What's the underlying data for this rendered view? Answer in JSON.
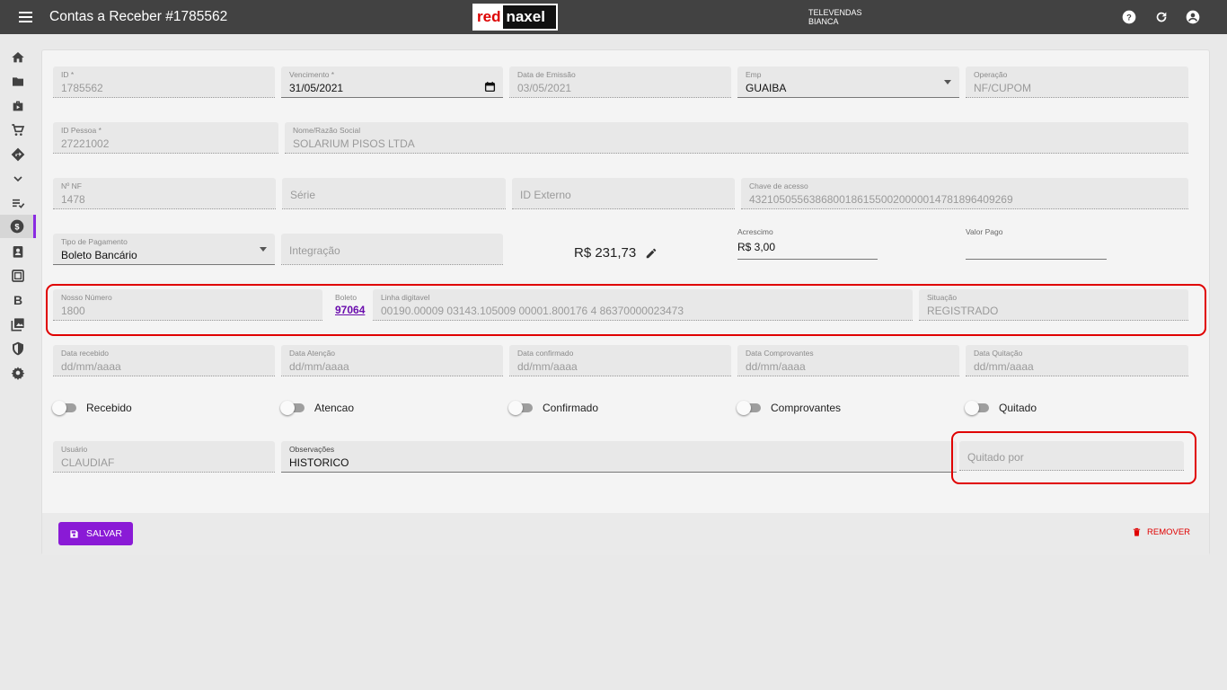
{
  "header": {
    "title": "Contas a Receber #1785562",
    "logo_red": "red",
    "logo_rest": "naxel",
    "user_line1": "TELEVENDAS",
    "user_line2": "BIANCA"
  },
  "sidebar": {
    "items": [
      "home-icon",
      "folder-icon",
      "briefcase-icon",
      "cart-icon",
      "directions-icon",
      "chevron-down-icon",
      "playlist-check-icon",
      "dollar-icon",
      "assignment-icon",
      "inbox-icon",
      "B",
      "photo-library-icon",
      "shield-icon",
      "gear-icon"
    ],
    "active": "dollar-icon",
    "b_label": "B"
  },
  "form": {
    "id": {
      "label": "ID *",
      "value": "1785562"
    },
    "vencimento": {
      "label": "Vencimento *",
      "value": "31/05/2021"
    },
    "data_emissao": {
      "label": "Data de Emissão",
      "value": "03/05/2021"
    },
    "emp": {
      "label": "Emp",
      "value": "GUAIBA"
    },
    "operacao": {
      "label": "Operação",
      "value": "NF/CUPOM"
    },
    "id_pessoa": {
      "label": "ID Pessoa *",
      "value": "27221002"
    },
    "nome": {
      "label": "Nome/Razão Social",
      "value": "SOLARIUM PISOS LTDA"
    },
    "nf": {
      "label": "Nº NF",
      "value": "1478"
    },
    "serie": {
      "placeholder": "Série"
    },
    "id_externo": {
      "placeholder": "ID Externo"
    },
    "chave": {
      "label": "Chave de acesso",
      "value": "43210505563868001861550020000014781896409269"
    },
    "tipo_pagamento": {
      "label": "Tipo de Pagamento",
      "value": "Boleto Bancário"
    },
    "integracao": {
      "placeholder": "Integração"
    },
    "valor": "R$ 231,73",
    "acrescimo": {
      "label": "Acrescimo",
      "value": "R$ 3,00"
    },
    "valor_pago": {
      "label": "Valor Pago",
      "value": ""
    },
    "nosso_numero": {
      "label": "Nosso Número",
      "value": "1800"
    },
    "boleto": {
      "label": "Boleto",
      "value": "97064"
    },
    "linha_digitavel": {
      "label": "Linha digitavel",
      "value": "00190.00009 03143.105009 00001.800176 4 86370000023473"
    },
    "situacao": {
      "label": "Situação",
      "value": "REGISTRADO"
    },
    "data_recebido": {
      "label": "Data recebido",
      "value": "dd/mm/aaaa"
    },
    "data_atencao": {
      "label": "Data Atenção",
      "value": "dd/mm/aaaa"
    },
    "data_confirmado": {
      "label": "Data confirmado",
      "value": "dd/mm/aaaa"
    },
    "data_comprovantes": {
      "label": "Data Comprovantes",
      "value": "dd/mm/aaaa"
    },
    "data_quitacao": {
      "label": "Data Quitação",
      "value": "dd/mm/aaaa"
    },
    "toggles": [
      {
        "label": "Recebido",
        "on": false
      },
      {
        "label": "Atencao",
        "on": false
      },
      {
        "label": "Confirmado",
        "on": false
      },
      {
        "label": "Comprovantes",
        "on": false
      },
      {
        "label": "Quitado",
        "on": false
      }
    ],
    "usuario": {
      "label": "Usuário",
      "value": "CLAUDIAF"
    },
    "observacoes": {
      "label": "Observações",
      "value": "HISTORICO"
    },
    "quitado_por": {
      "placeholder": "Quitado por"
    }
  },
  "actions": {
    "save_label": "SALVAR",
    "remove_label": "REMOVER"
  },
  "colors": {
    "topbar": "#424242",
    "accent": "#8a1ad6",
    "danger": "#e00000",
    "highlight": "#e00000"
  }
}
